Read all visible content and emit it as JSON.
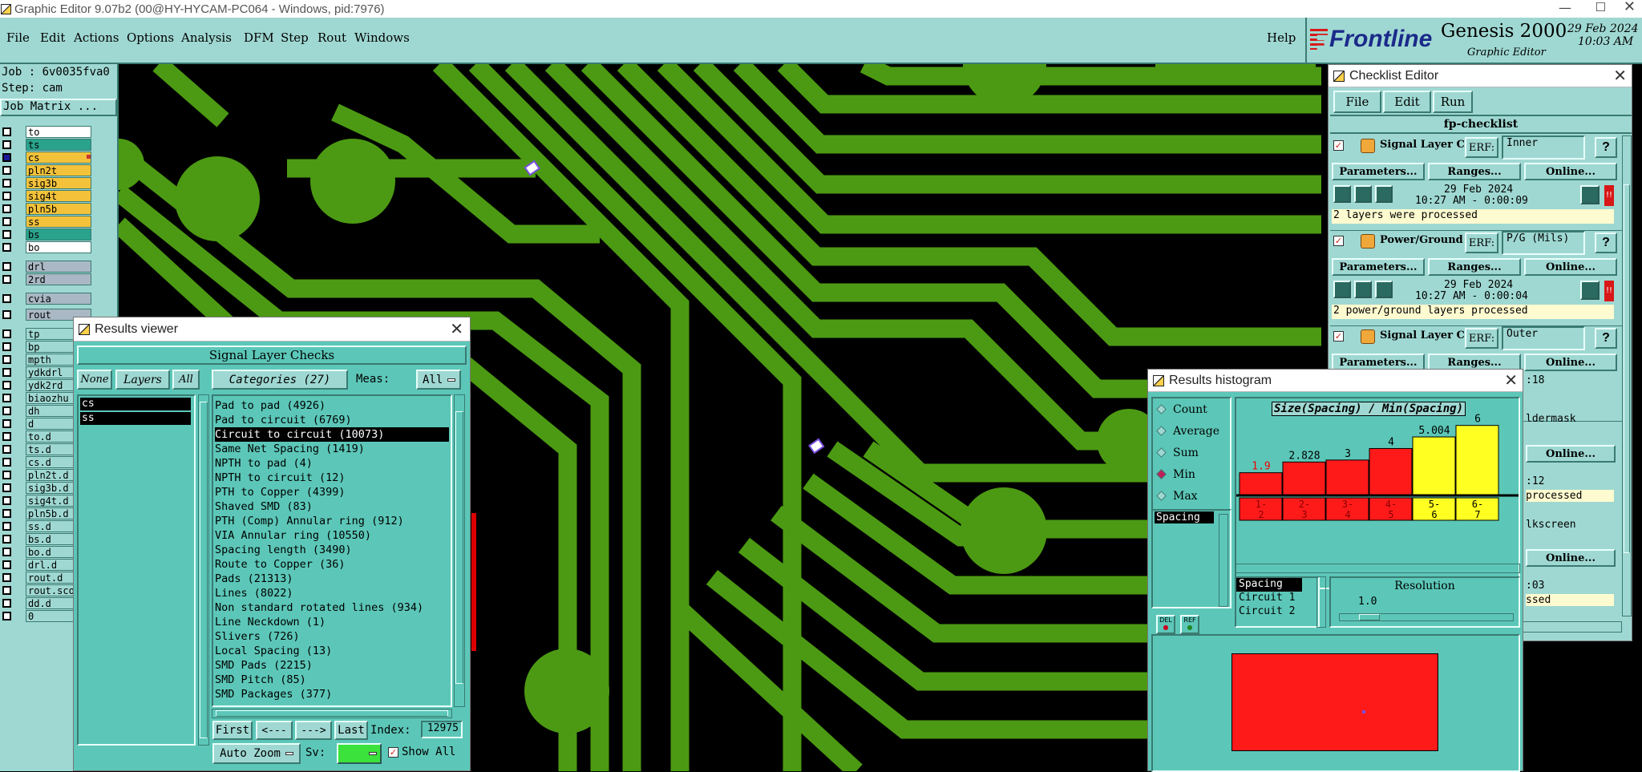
{
  "titlebar": {
    "title": "Graphic Editor 9.07b2 (00@HY-HYCAM-PC064 - Windows, pid:7976)"
  },
  "menu": {
    "items": [
      "File",
      "Edit",
      "Actions",
      "Options",
      "Analysis",
      "DFM",
      "Step",
      "Rout",
      "Windows"
    ],
    "help": "Help"
  },
  "brand": {
    "logo": "Frontline",
    "product": "Genesis 2000",
    "subtitle": "Graphic Editor",
    "date": "29 Feb 2024",
    "time": "10:03 AM"
  },
  "job": {
    "job": "Job : 6v0035fva0",
    "step": "Step: cam",
    "matrix_button": "Job Matrix ..."
  },
  "layers": [
    {
      "name": "to",
      "color": "#ffffff"
    },
    {
      "name": "ts",
      "color": "#2aa38c"
    },
    {
      "name": "cs",
      "color": "#f3c23a",
      "selected": true
    },
    {
      "name": "pln2t",
      "color": "#f3c23a"
    },
    {
      "name": "sig3b",
      "color": "#f3c23a"
    },
    {
      "name": "sig4t",
      "color": "#f3c23a"
    },
    {
      "name": "pln5b",
      "color": "#f3c23a"
    },
    {
      "name": "ss",
      "color": "#f3c23a"
    },
    {
      "name": "bs",
      "color": "#2aa38c"
    },
    {
      "name": "bo",
      "color": "#ffffff"
    },
    {
      "name": "drl",
      "color": "#a9b8c4"
    },
    {
      "name": "2rd",
      "color": "#a9b8c4"
    },
    {
      "name": "cvia",
      "color": "#a9b8c4"
    },
    {
      "name": "rout",
      "color": "#a9b8c4"
    },
    {
      "name": "tp",
      "color": "#9fd8d2"
    },
    {
      "name": "bp",
      "color": "#9fd8d2"
    },
    {
      "name": "mpth",
      "color": "#9fd8d2"
    },
    {
      "name": "ydkdrl",
      "color": "#9fd8d2"
    },
    {
      "name": "ydk2rd",
      "color": "#9fd8d2"
    },
    {
      "name": "biaozhu",
      "color": "#9fd8d2"
    },
    {
      "name": "dh",
      "color": "#9fd8d2"
    },
    {
      "name": "d",
      "color": "#9fd8d2"
    },
    {
      "name": "to.d",
      "color": "#9fd8d2"
    },
    {
      "name": "ts.d",
      "color": "#9fd8d2"
    },
    {
      "name": "cs.d",
      "color": "#9fd8d2"
    },
    {
      "name": "pln2t.d",
      "color": "#9fd8d2"
    },
    {
      "name": "sig3b.d",
      "color": "#9fd8d2"
    },
    {
      "name": "sig4t.d",
      "color": "#9fd8d2"
    },
    {
      "name": "pln5b.d",
      "color": "#9fd8d2"
    },
    {
      "name": "ss.d",
      "color": "#9fd8d2"
    },
    {
      "name": "bs.d",
      "color": "#9fd8d2"
    },
    {
      "name": "bo.d",
      "color": "#9fd8d2"
    },
    {
      "name": "drl.d",
      "color": "#9fd8d2"
    },
    {
      "name": "rout.d",
      "color": "#9fd8d2"
    },
    {
      "name": "rout.sco",
      "color": "#9fd8d2"
    },
    {
      "name": "dd.d",
      "color": "#9fd8d2"
    },
    {
      "name": "0",
      "color": "#9fd8d2"
    }
  ],
  "results_viewer": {
    "title": "Results viewer",
    "header": "Signal Layer Checks",
    "none_btn": "None",
    "layers_btn": "Layers",
    "all_btn": "All",
    "categories_btn": "Categories (27)",
    "meas_label": "Meas:",
    "meas_value": "All",
    "layer_list": [
      "cs",
      "ss"
    ],
    "categories": [
      "Pad to pad (4926)",
      "Pad to circuit (6769)",
      "Circuit to circuit (10073)",
      "Same Net Spacing (1419)",
      "NPTH to pad (4)",
      "NPTH to circuit (12)",
      "PTH to Copper (4399)",
      "Shaved SMD (83)",
      "PTH (Comp) Annular ring (912)",
      "VIA Annular ring (10550)",
      "Spacing length (3490)",
      "Route to Copper (36)",
      "Pads (21313)",
      "Lines (8022)",
      "Non standard rotated lines (934)",
      "Line Neckdown (1)",
      "Slivers (726)",
      "Local Spacing (13)",
      "SMD Pads (2215)",
      "SMD Pitch (85)",
      "SMD Packages (377)"
    ],
    "selected_category": 2,
    "nav": {
      "first": "First",
      "prev": "<---",
      "next": "--->",
      "last": "Last",
      "index_label": "Index:",
      "index_value": "12975"
    },
    "auto_zoom": "Auto Zoom",
    "sv_label": "Sv:",
    "show_all": "Show All"
  },
  "checklist": {
    "title": "Checklist Editor",
    "menu": [
      "File",
      "Edit",
      "Run"
    ],
    "name": "fp-checklist",
    "erf_label": "ERF:",
    "param_btn": "Parameters...",
    "ranges_btn": "Ranges...",
    "online_btn": "Online...",
    "help_btn": "?",
    "items": [
      {
        "name": "Signal Layer Ch",
        "erf": "Inner",
        "date": "29 Feb 2024",
        "time": "10:27 AM - 0:00:09",
        "msg": "2 layers were processed"
      },
      {
        "name": "Power/Ground C",
        "erf": "P/G (Mils)",
        "date": "29 Feb 2024",
        "time": "10:27 AM - 0:00:04",
        "msg": "2 power/ground layers processed"
      },
      {
        "name": "Signal Layer Ch",
        "erf": "Outer",
        "time_tail": ":18",
        "msg_tail": "ldermask",
        "msg2": "processed",
        "msg3": "lkscreen",
        "time_tail2": ":12",
        "time_tail3": ":03",
        "msg4": "ssed"
      }
    ]
  },
  "histogram": {
    "title": "Results histogram",
    "radios": [
      "Count",
      "Average",
      "Sum",
      "Min",
      "Max"
    ],
    "selected_radio": "Min",
    "measure": "Spacing",
    "chart_title": "Size(Spacing) / Min(Spacing)",
    "legend_items": [
      "Spacing",
      "Circuit 1",
      "Circuit 2"
    ],
    "resolution_label": "Resolution",
    "resolution_value": "1.0",
    "chart_data": {
      "type": "bar",
      "categories": [
        "1-2",
        "2-3",
        "3-4",
        "4-5",
        "5-6",
        "6-7"
      ],
      "values": [
        1.9,
        2.828,
        3,
        4,
        5.004,
        6
      ],
      "value_labels": [
        "1.9",
        "2.828",
        "3",
        "4",
        "5.004",
        "6"
      ],
      "bar_colors": [
        "#ff1a1a",
        "#ff1a1a",
        "#ff1a1a",
        "#ff1a1a",
        "#ffff22",
        "#ffff22"
      ],
      "ylim": [
        0,
        6.5
      ]
    }
  }
}
